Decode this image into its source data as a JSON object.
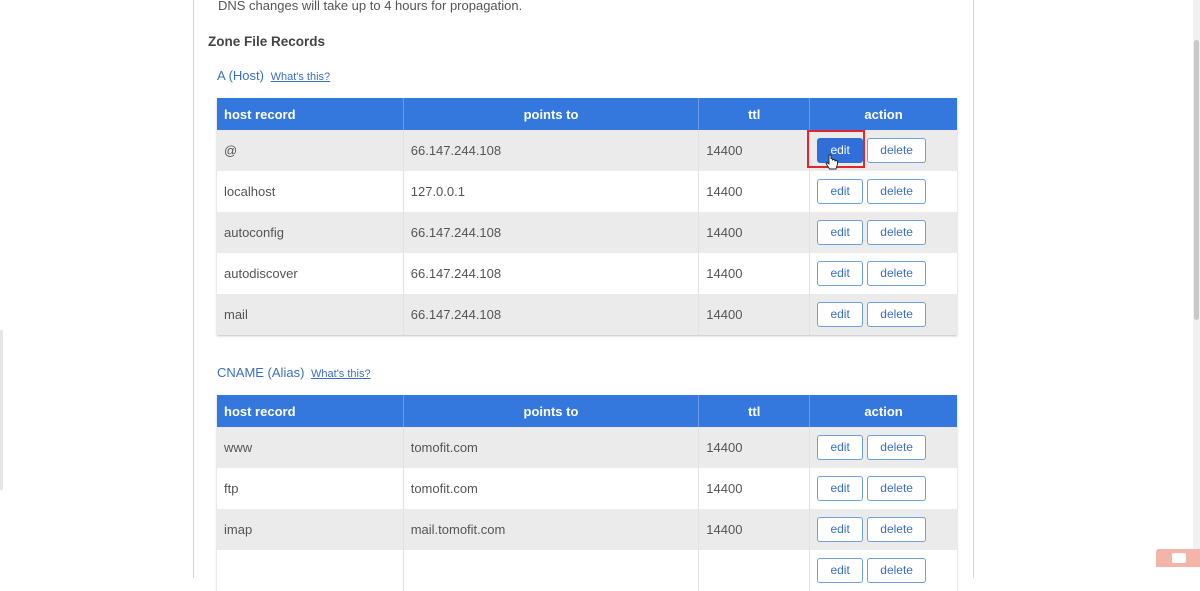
{
  "notice": "DNS changes will take up to 4 hours for propagation.",
  "zone_title": "Zone File Records",
  "sections": {
    "a_host": {
      "title": "A (Host)",
      "help_link": "What's this?",
      "headers": [
        "host record",
        "points to",
        "ttl",
        "action"
      ],
      "rows": [
        {
          "host": "@",
          "points_to": "66.147.244.108",
          "ttl": "14400"
        },
        {
          "host": "localhost",
          "points_to": "127.0.0.1",
          "ttl": "14400"
        },
        {
          "host": "autoconfig",
          "points_to": "66.147.244.108",
          "ttl": "14400"
        },
        {
          "host": "autodiscover",
          "points_to": "66.147.244.108",
          "ttl": "14400"
        },
        {
          "host": "mail",
          "points_to": "66.147.244.108",
          "ttl": "14400"
        }
      ]
    },
    "cname": {
      "title": "CNAME (Alias)",
      "help_link": "What's this?",
      "headers": [
        "host record",
        "points to",
        "ttl",
        "action"
      ],
      "rows": [
        {
          "host": "www",
          "points_to": "tomofit.com",
          "ttl": "14400"
        },
        {
          "host": "ftp",
          "points_to": "tomofit.com",
          "ttl": "14400"
        },
        {
          "host": "imap",
          "points_to": "mail.tomofit.com",
          "ttl": "14400"
        },
        {
          "host": "",
          "points_to": "",
          "ttl": ""
        }
      ]
    }
  },
  "buttons": {
    "edit": "edit",
    "delete": "delete"
  },
  "active_edit_row": "a_host.0",
  "colors": {
    "header_blue": "#3578dd",
    "link_blue": "#3a6fc4",
    "highlight_red": "#e0262e"
  },
  "icons": [
    "hand-cursor-icon",
    "youtube-icon"
  ]
}
